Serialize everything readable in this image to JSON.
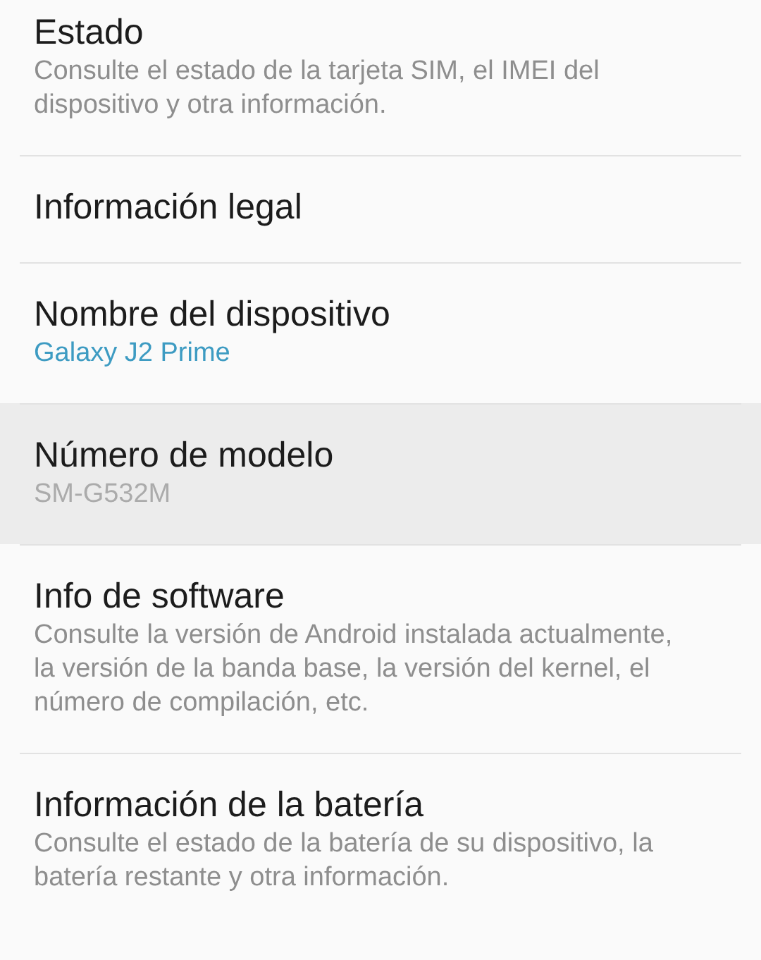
{
  "settings_items": [
    {
      "title": "Estado",
      "summary": "Consulte el estado de la tarjeta SIM, el IMEI del dispositivo y otra información.",
      "kind": "description",
      "highlighted": false
    },
    {
      "title": "Información legal",
      "highlighted": false
    },
    {
      "title": "Nombre del dispositivo",
      "summary": "Galaxy J2 Prime",
      "kind": "accent",
      "highlighted": false
    },
    {
      "title": "Número de modelo",
      "summary": "SM-G532M",
      "kind": "dim",
      "highlighted": true
    },
    {
      "title": "Info de software",
      "summary": "Consulte la versión de Android instalada actualmente, la versión de la banda base, la versión del kernel, el número de compilación, etc.",
      "kind": "description",
      "highlighted": false
    },
    {
      "title": "Información de la batería",
      "summary": "Consulte el estado de la batería de su dispositivo, la batería restante y otra información.",
      "kind": "description",
      "highlighted": false
    }
  ]
}
